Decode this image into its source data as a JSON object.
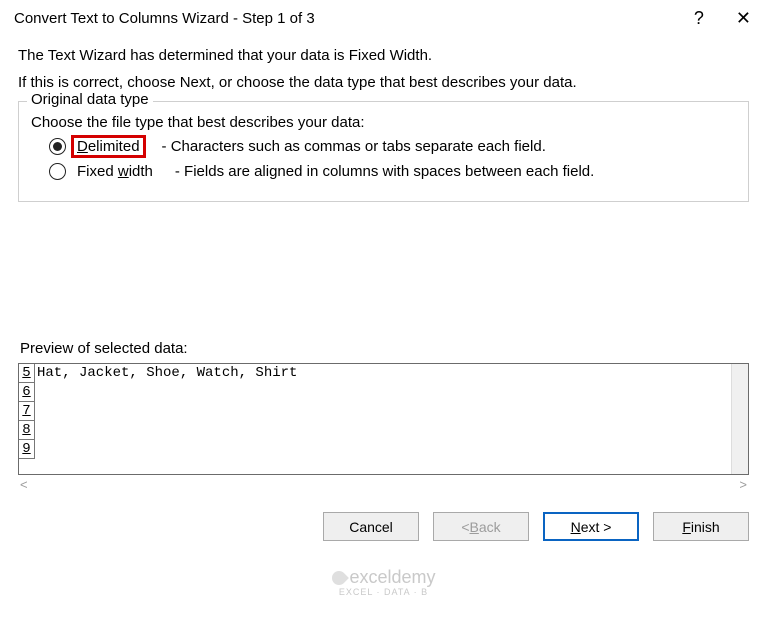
{
  "titlebar": {
    "title": "Convert Text to Columns Wizard - Step 1 of 3",
    "help_glyph": "?",
    "close_glyph": "✕"
  },
  "intro": {
    "line1": "The Text Wizard has determined that your data is Fixed Width.",
    "line2": "If this is correct, choose Next, or choose the data type that best describes your data."
  },
  "original_data_type": {
    "legend": "Original data type",
    "choose": "Choose the file type that best describes your data:",
    "delimited": {
      "accel": "D",
      "rest": "elimited",
      "desc": "- Characters such as commas or tabs separate each field."
    },
    "fixed": {
      "pre": "Fixed ",
      "accel": "w",
      "rest": "idth",
      "desc": "- Fields are aligned in columns with spaces between each field."
    }
  },
  "preview": {
    "label": "Preview of selected data:",
    "rows": [
      {
        "n": "5",
        "text": "Hat, Jacket, Shoe, Watch, Shirt"
      },
      {
        "n": "6",
        "text": ""
      },
      {
        "n": "7",
        "text": ""
      },
      {
        "n": "8",
        "text": ""
      },
      {
        "n": "9",
        "text": ""
      }
    ]
  },
  "hscroll": {
    "left_glyph": "<",
    "right_glyph": ">"
  },
  "buttons": {
    "cancel": "Cancel",
    "back_lt": "< ",
    "back_accel": "B",
    "back_rest": "ack",
    "next_accel": "N",
    "next_rest": "ext >",
    "finish_accel": "F",
    "finish_rest": "inish"
  },
  "watermark": {
    "brand": "exceldemy",
    "sub": "EXCEL · DATA · B"
  }
}
